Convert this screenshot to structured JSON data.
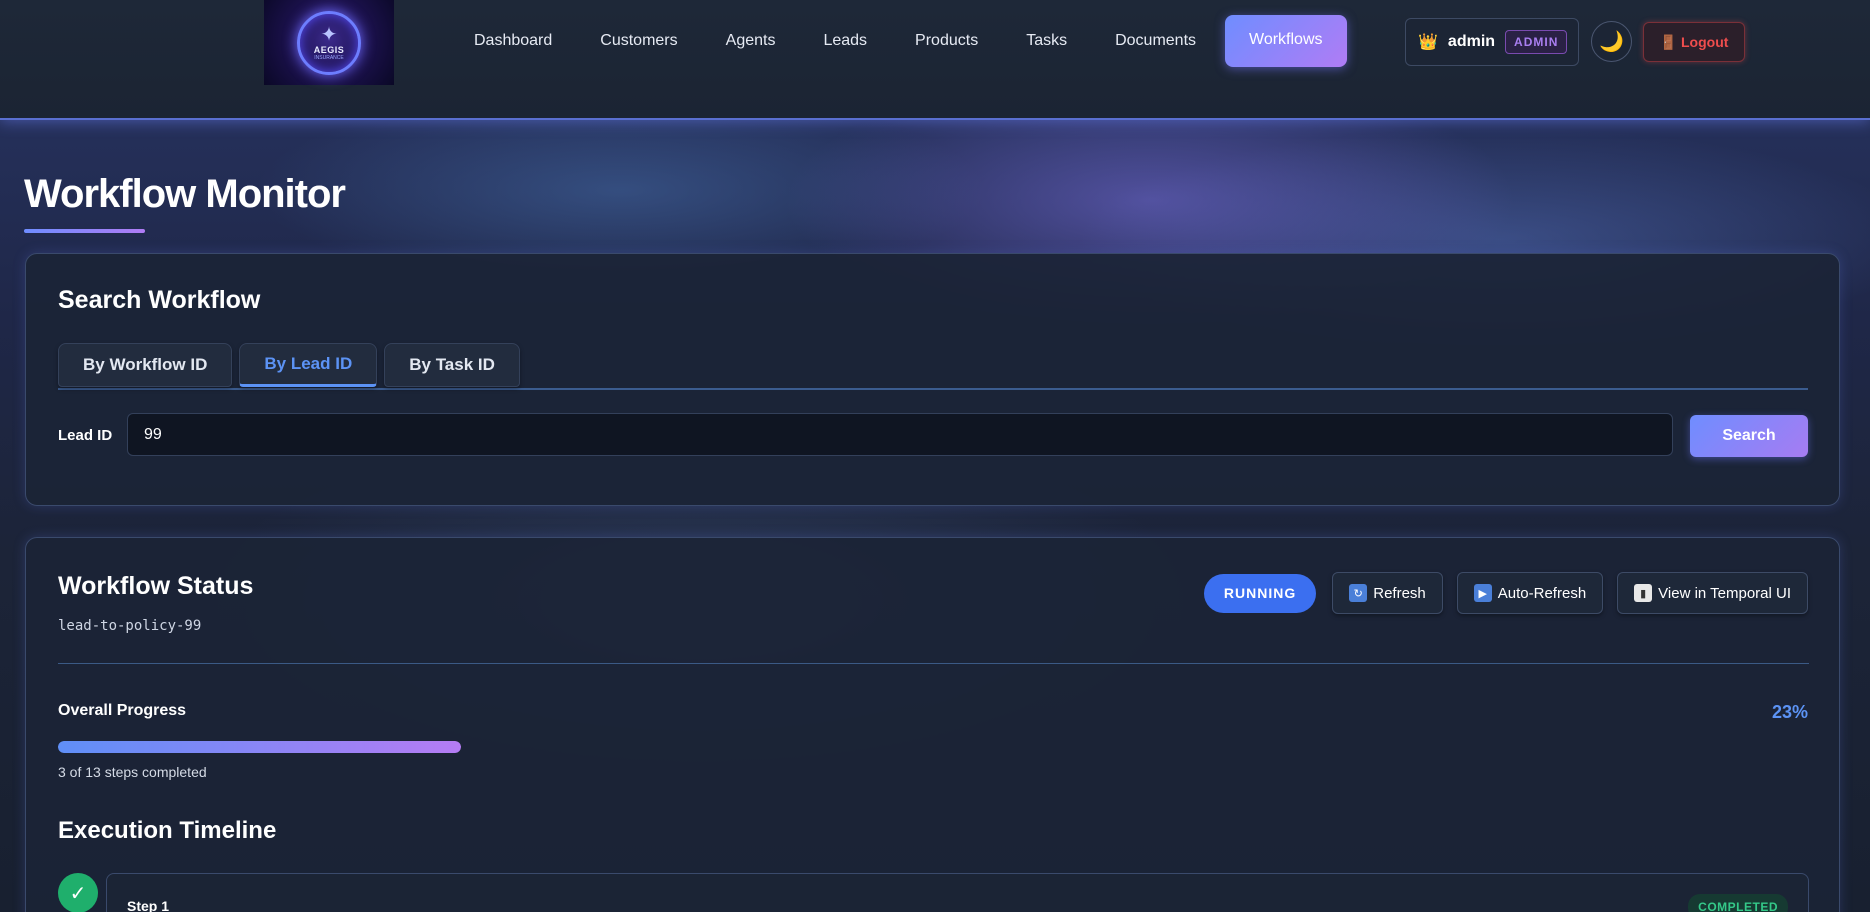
{
  "nav": {
    "logo_text": "AEGIS",
    "logo_sub": "INSURANCE",
    "links": [
      "Dashboard",
      "Customers",
      "Agents",
      "Leads",
      "Products",
      "Tasks",
      "Documents"
    ],
    "active_link": "Workflows",
    "user": {
      "name": "admin",
      "role": "ADMIN",
      "crown_icon": "👑"
    },
    "theme_icon": "🌙",
    "logout_icon": "🚪",
    "logout_label": "Logout"
  },
  "page": {
    "title": "Workflow Monitor"
  },
  "search": {
    "title": "Search Workflow",
    "tabs": [
      "By Workflow ID",
      "By Lead ID",
      "By Task ID"
    ],
    "active_tab": 1,
    "field_label": "Lead ID",
    "field_value": "99",
    "button_label": "Search"
  },
  "status": {
    "title": "Workflow Status",
    "workflow_id": "lead-to-policy-99",
    "state": "RUNNING",
    "actions": {
      "refresh": "Refresh",
      "auto_refresh": "Auto-Refresh",
      "temporal": "View in Temporal UI"
    },
    "progress_label": "Overall Progress",
    "progress_percent": "23%",
    "progress_fraction": 0.23,
    "progress_sub": "3 of 13 steps completed",
    "timeline_title": "Execution Timeline",
    "steps": [
      {
        "name": "Step 1",
        "status": "COMPLETED"
      }
    ]
  },
  "colors": {
    "accent": "#5c93f5",
    "accent_gradient_end": "#b07cf5",
    "success": "#1faf6c",
    "danger": "#ef4d4d"
  }
}
